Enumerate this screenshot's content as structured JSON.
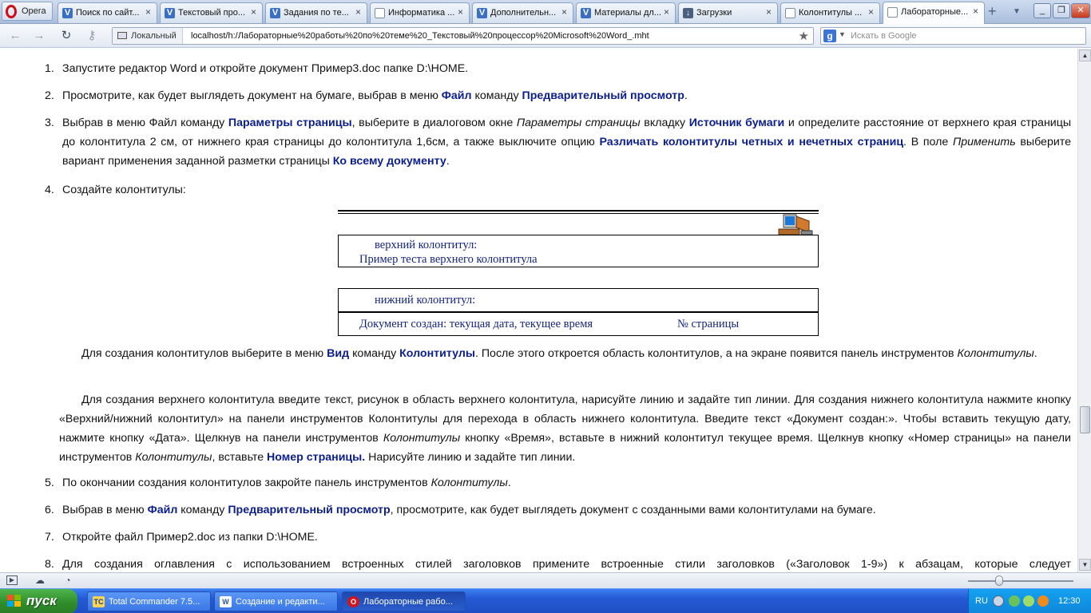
{
  "browser": {
    "app_button": "Opera",
    "tabs": [
      {
        "label": "Поиск по сайт...",
        "icon": "v"
      },
      {
        "label": "Текстовый про...",
        "icon": "v"
      },
      {
        "label": "Задания по те...",
        "icon": "v"
      },
      {
        "label": "Информатика ...",
        "icon": "doc"
      },
      {
        "label": "Дополнительн...",
        "icon": "v"
      },
      {
        "label": "Материалы дл...",
        "icon": "v"
      },
      {
        "label": "Загрузки",
        "icon": "download"
      },
      {
        "label": "Колонтитулы ...",
        "icon": "doc"
      },
      {
        "label": "Лабораторные...",
        "icon": "doc",
        "active": true
      }
    ],
    "address_label": "Локальный",
    "url": "localhost/h:/Лабораторные%20работы%20по%20теме%20_Текстовый%20процессор%20Microsoft%20Word_.mht",
    "search_placeholder": "Искать в Google"
  },
  "content": {
    "steps": [
      {
        "num": "1.",
        "html": "Запустите редактор Word и откройте документ Пример3.doc папке D:\\HOME."
      },
      {
        "num": "2.",
        "html": "Просмотрите, как будет выглядеть документ на бумаге, выбрав в меню <b class=\"b\">Файл</b> команду <b class=\"b\">Предварительный просмотр</b>."
      },
      {
        "num": "3.",
        "html": "Выбрав в меню Файл команду <b class=\"b\">Параметры страницы</b>, выберите в диалоговом окне <span class=\"i\">Параметры страницы</span> вкладку <b class=\"b\">Источник бумаги</b> и определите расстояние от верхнего края страницы до колонтитула 2 см, от нижнего края страницы до колонтитула 1,6см, а также выключите опцию <b class=\"b\">Различать колонтитулы четных и нечетных страниц</b>. В поле <span class=\"i\">Применить</span> выберите вариант применения заданной разметки страницы <b class=\"b\">Ко всему документу</b>."
      },
      {
        "num": "4.",
        "html": "Создайте колонтитулы:"
      },
      {
        "num": "5.",
        "html": "По окончании создания колонтитулов закройте панель инструментов <span class=\"i\">Колонтитулы</span>."
      },
      {
        "num": "6.",
        "html": "Выбрав в меню <b class=\"b\">Файл</b> команду <b class=\"b\">Предварительный просмотр</b>, просмотрите, как будет выглядеть документ с созданными вами колонтитулами на бумаге."
      },
      {
        "num": "7.",
        "html": "Откройте файл Пример2.doc из папки D:\\HOME."
      },
      {
        "num": "8.",
        "html": "Для создания оглавления с использованием встроенных стилей заголовков примените встроенные стили заголовков («Заголовок 1-9») к абзацам, которые следует"
      }
    ],
    "diagram": {
      "header_title": "верхний колонтитул:",
      "header_text": "Пример теста верхнего колонтитула",
      "footer_title": "нижний колонтитул:",
      "footer_text": "Документ создан: текущая дата, текущее время",
      "footer_page": "№ страницы"
    },
    "paragraphs": [
      "Для создания колонтитулов выберите в меню <b class=\"b\">Вид</b> команду <b class=\"b\">Колонтитулы</b>. После этого откроется область колонтитулов, а на экране появится панель инструментов <span class=\"i\">Колонтитулы</span>.",
      "Для создания верхнего колонтитула введите текст, рисунок в область верхнего колонтитула, нарисуйте линию и задайте тип линии. Для создания нижнего колонтитула нажмите кнопку «Верхний/нижний колонтитул» на панели инструментов Колонтитулы для перехода в область нижнего колонтитула. Введите текст «Документ создан:». Чтобы вставить текущую дату, нажмите кнопку «Дата». Щелкнув на панели инструментов <span class=\"i\">Колонтитулы</span> кнопку «Время», вставьте в нижний колонтитул текущее время. Щелкнув кнопку «Номер страницы» на панели инструментов <span class=\"i\">Колонтитулы</span>, вставьте <b class=\"b\">Номер страницы.</b> Нарисуйте линию и задайте тип линии."
    ]
  },
  "taskbar": {
    "start_label": "пуск",
    "tasks": [
      {
        "label": "Total Commander 7.5...",
        "icon": "tc"
      },
      {
        "label": "Создание и редакти...",
        "icon": "word"
      },
      {
        "label": "Лабораторные рабо...",
        "icon": "opera",
        "active": true
      }
    ],
    "lang": "RU",
    "clock": "12:30"
  },
  "colors": {
    "bold_text": "#0b1e8c",
    "diagram_text": "#14247e",
    "taskbar": "#2459d4",
    "start": "#2e8b29",
    "tray": "#0f86db"
  }
}
